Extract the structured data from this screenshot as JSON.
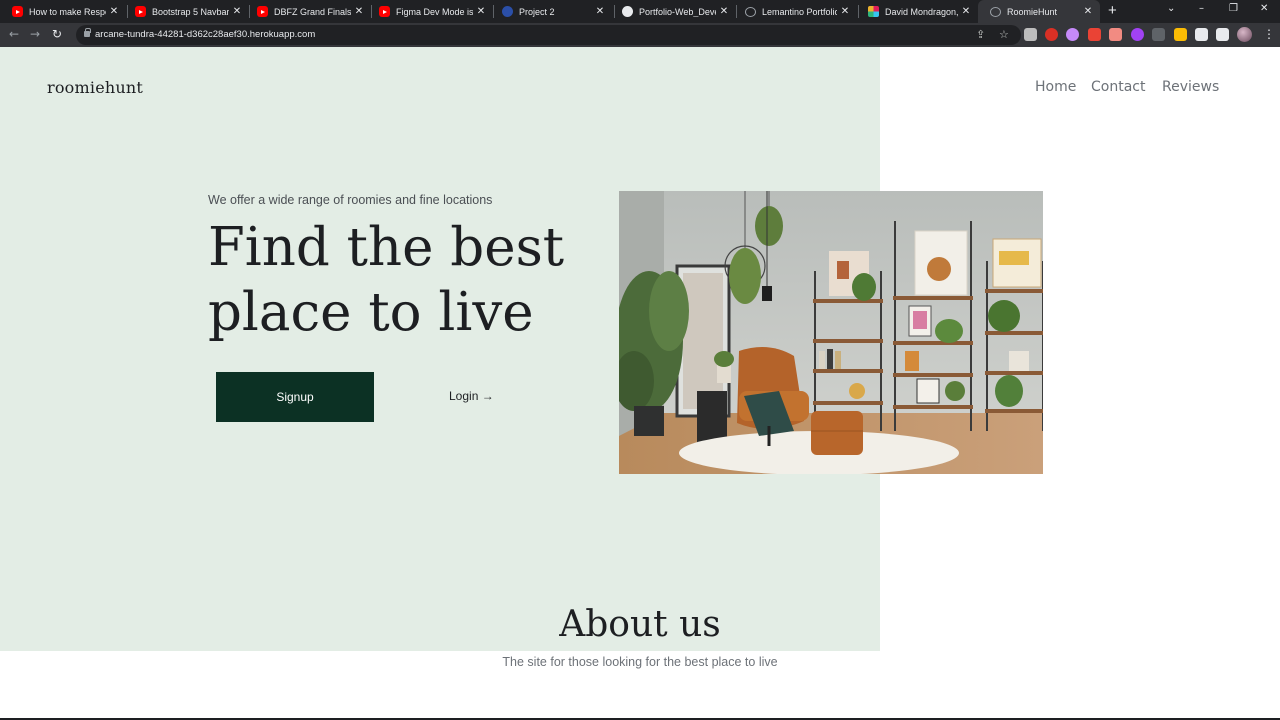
{
  "browser": {
    "tabs": [
      {
        "title": "How to make Respons",
        "icon": "youtube-icon"
      },
      {
        "title": "Bootstrap 5 Navbar Tu",
        "icon": "youtube-icon"
      },
      {
        "title": "DBFZ Grand Finals: Za",
        "icon": "youtube-icon"
      },
      {
        "title": "Figma Dev Mode is he",
        "icon": "youtube-icon"
      },
      {
        "title": "Project 2",
        "icon": "project-icon"
      },
      {
        "title": "Portfolio-Web_Develo",
        "icon": "github-icon"
      },
      {
        "title": "Lemantino Portfolio",
        "icon": "globe-icon"
      },
      {
        "title": "David Mondragon, En",
        "icon": "slack-icon"
      },
      {
        "title": "RoomieHunt",
        "icon": "globe-icon",
        "active": true
      }
    ],
    "url": "arcane-tundra-44281-d362c28aef30.herokuapp.com"
  },
  "site": {
    "brand": "roomiehunt",
    "nav": [
      "Home",
      "Contact",
      "Reviews"
    ],
    "hero": {
      "tagline": "We offer a wide range of roomies and fine locations",
      "title": "Find the best place to live",
      "signup_label": "Signup",
      "login_label": "Login →"
    },
    "about": {
      "title": "About us",
      "subtitle": "The site for those looking for the best place to live"
    }
  },
  "colors": {
    "panel": "#e3ede5",
    "button": "#0c3124",
    "text": "#1d1f22",
    "muted": "#6d7278"
  }
}
